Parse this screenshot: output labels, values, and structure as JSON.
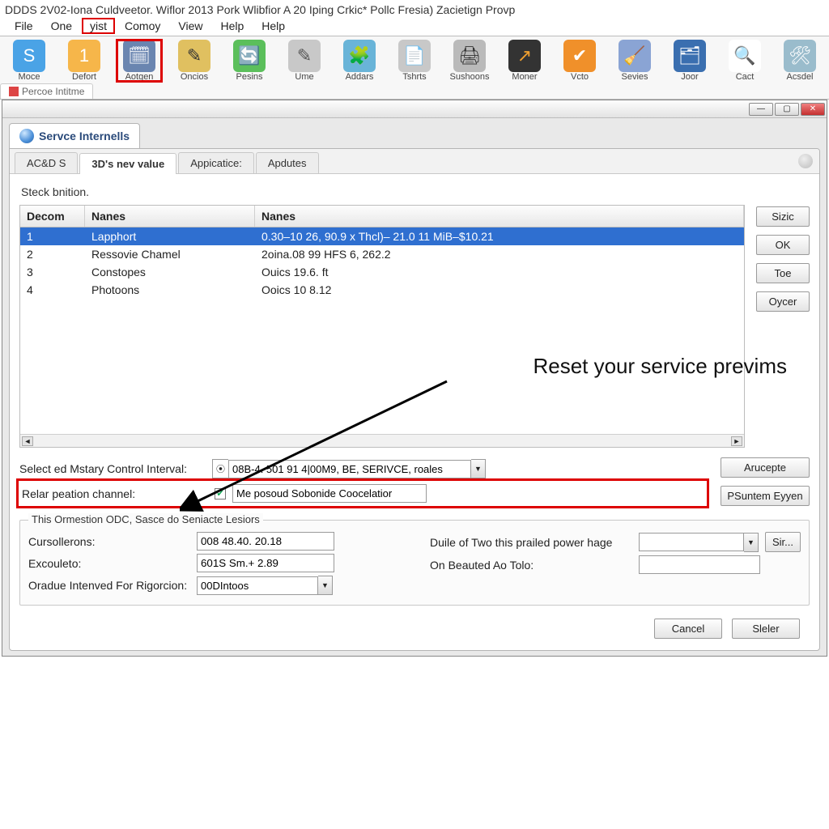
{
  "app_title": "DDDS 2V02-Iona Culdveetor. Wiflor 2013 Pork Wlibfior A 20 Iping Crkic* Pollc Fresia) Zacietign Provp",
  "menubar": [
    "File",
    "One",
    "yist",
    "Comoy",
    "View",
    "Help",
    "Help"
  ],
  "toolbar": [
    {
      "label": "Moce",
      "icon": "S",
      "bg": "#4aa3e6",
      "fg": "#fff"
    },
    {
      "label": "Defort",
      "icon": "1",
      "bg": "#f6b64a",
      "fg": "#fff"
    },
    {
      "label": "Aotgen",
      "icon": "🗓",
      "bg": "#6a85b0",
      "fg": "#fff"
    },
    {
      "label": "Oncios",
      "icon": "✎",
      "bg": "#e0c060",
      "fg": "#333"
    },
    {
      "label": "Pesins",
      "icon": "🔄",
      "bg": "#5bbf5b",
      "fg": "#fff"
    },
    {
      "label": "Ume",
      "icon": "✎",
      "bg": "#c8c8c8",
      "fg": "#555"
    },
    {
      "label": "Addars",
      "icon": "🧩",
      "bg": "#69b4d8",
      "fg": "#fff"
    },
    {
      "label": "Tshrts",
      "icon": "📄",
      "bg": "#c8c8c8",
      "fg": "#555"
    },
    {
      "label": "Sushoons",
      "icon": "🖨",
      "bg": "#bababa",
      "fg": "#333"
    },
    {
      "label": "Moner",
      "icon": "↗",
      "bg": "#333",
      "fg": "#f0a030"
    },
    {
      "label": "Vcto",
      "icon": "✔",
      "bg": "#f0902a",
      "fg": "#fff"
    },
    {
      "label": "Sevies",
      "icon": "🧹",
      "bg": "#8aa4d4",
      "fg": "#fff"
    },
    {
      "label": "Joor",
      "icon": "🗂",
      "bg": "#3a6fb0",
      "fg": "#fff"
    },
    {
      "label": "Cact",
      "icon": "🔍",
      "bg": "#ffffff",
      "fg": "#c33"
    },
    {
      "label": "Acsdel",
      "icon": "🛠",
      "bg": "#9abccc",
      "fg": "#fff"
    }
  ],
  "doc_tab": "Percoe Intitme",
  "service_tab_label": "Servce Internells",
  "sub_tabs": [
    "AC&D S",
    "3D's nev value",
    "Appicatice:",
    "Apdutes"
  ],
  "steck_label": "Steck bnition.",
  "grid": {
    "headers": [
      "Decom",
      "Nanes",
      "Nanes"
    ],
    "rows": [
      {
        "c1": "1",
        "c2": "Lapphort",
        "c3": "0.30–10 26, 90.9 x Thcl)– 21.0 11 MiB–$10.21"
      },
      {
        "c1": "2",
        "c2": "Ressovie Chamel",
        "c3": "2oina.08 99 HFS 6, 262.2"
      },
      {
        "c1": "3",
        "c2": "Constopes",
        "c3": "Ouics 19.6. ft"
      },
      {
        "c1": "4",
        "c2": "Photoons",
        "c3": "Ooics 10 8.12"
      }
    ]
  },
  "side_buttons": [
    "Sizic",
    "OK",
    "Toe",
    "Oycer"
  ],
  "row_control_label": "Select ed Mstary Control Interval:",
  "row_control_value": "08B-4. 501 91 4|00M9, BE, SERIVCE, roales",
  "row_relar_label": "Relar peation channel:",
  "row_relar_value": "Me posoud Sobonide Coocelatior",
  "right_buttons": [
    "Arucepte",
    "PSuntem Eyyen"
  ],
  "fieldset_legend": "This Ormestion ODC, Sasce do Seniacte Lesiors",
  "f_cursollerons_label": "Cursollerons:",
  "f_cursollerons_value": "008 48.40. 20.18",
  "f_excouleto_label": "Excouleto:",
  "f_excouleto_value": "601S Sm.+ 2.89",
  "f_oradue_label": "Oradue Intenved For Rigorcion:",
  "f_oradue_value": "00DIntoos",
  "f_duile_label": "Duile of Two this prailed power hage",
  "f_duile_value": "",
  "f_onbeauted_label": "On Beauted Ao Tolo:",
  "f_onbeauted_value": "",
  "f_sir_label": "Sir...",
  "bottom_buttons": [
    "Cancel",
    "Sleler"
  ],
  "callout_text": "Reset your service previms"
}
